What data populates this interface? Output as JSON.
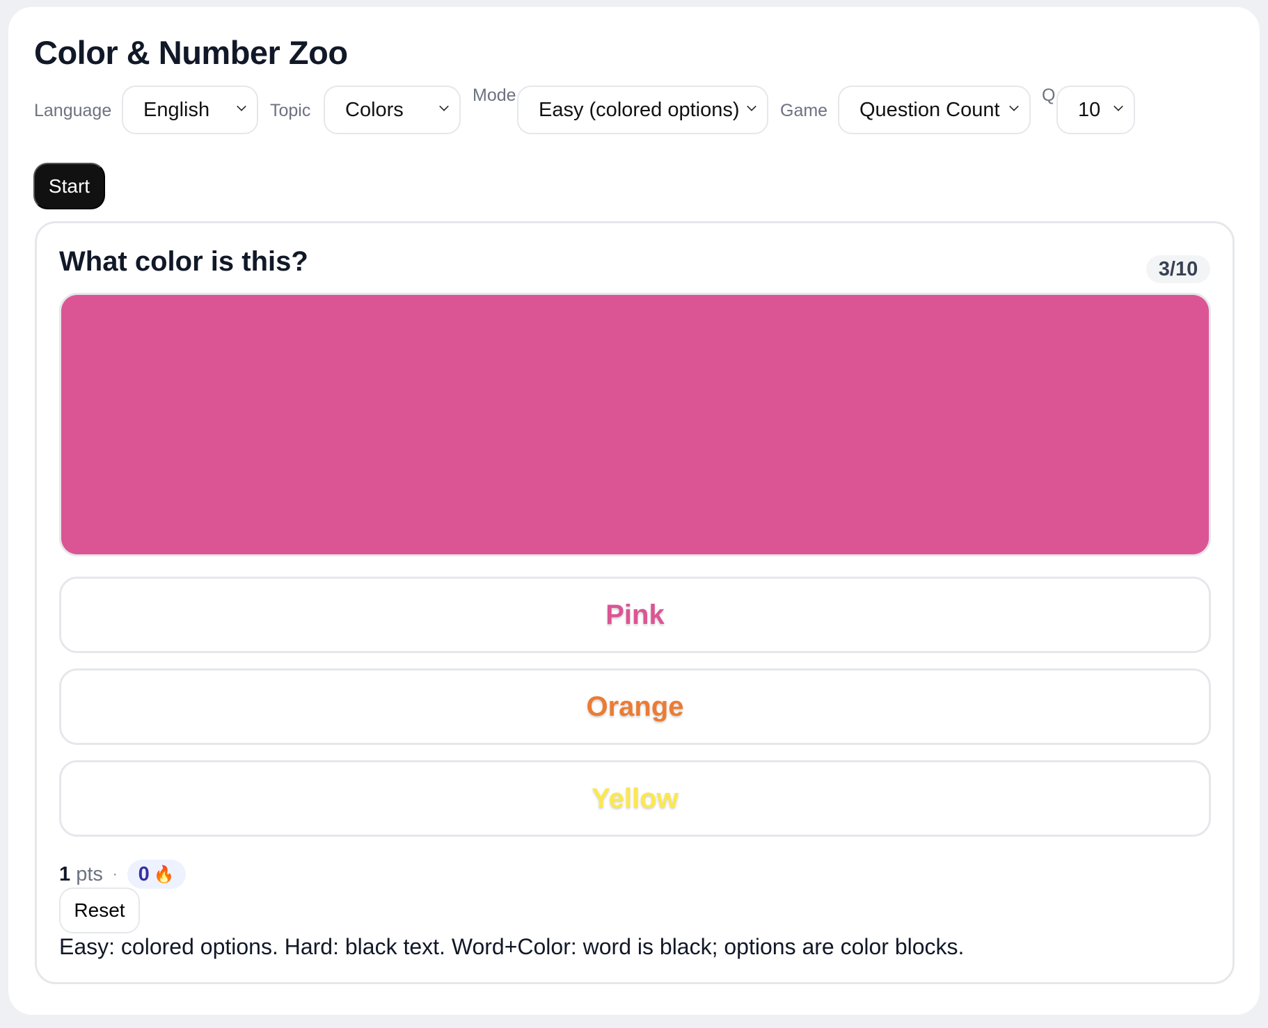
{
  "app": {
    "title": "Color & Number Zoo"
  },
  "controls": {
    "language": {
      "label": "Language",
      "value": "English"
    },
    "topic": {
      "label": "Topic",
      "value": "Colors"
    },
    "mode": {
      "label": "Mode",
      "value": "Easy (colored options)"
    },
    "game": {
      "label": "Game",
      "value": "Question Count"
    },
    "count": {
      "label": "Q",
      "value": "10"
    },
    "start_label": "Start"
  },
  "quiz": {
    "question": "What color is this?",
    "progress": "3/10",
    "swatch_color": "#db5594",
    "options": [
      {
        "label": "Pink",
        "color": "#db5594"
      },
      {
        "label": "Orange",
        "color": "#ea7c34"
      },
      {
        "label": "Yellow",
        "color": "#fbe84f"
      }
    ]
  },
  "score": {
    "points": "1",
    "points_unit": "pts",
    "separator": "·",
    "streak": "0",
    "streak_icon": "fire-icon",
    "streak_emoji": "🔥"
  },
  "reset_label": "Reset",
  "help_text": "Easy: colored options. Hard: black text. Word+Color: word is black; options are color blocks."
}
